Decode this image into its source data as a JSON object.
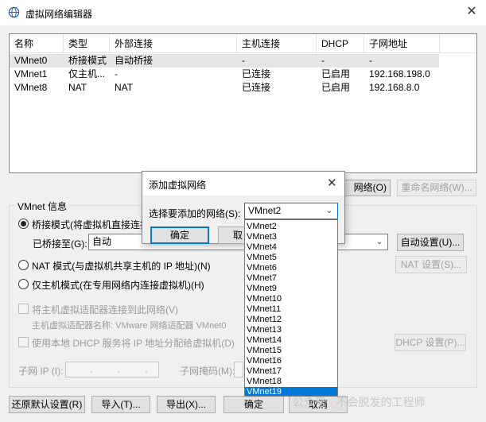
{
  "window": {
    "title": "虚拟网络编辑器",
    "close_glyph": "✕"
  },
  "table": {
    "columns": [
      "名称",
      "类型",
      "外部连接",
      "主机连接",
      "DHCP",
      "子网地址"
    ],
    "rows": [
      [
        "VMnet0",
        "桥接模式",
        "自动桥接",
        "-",
        "-",
        "-"
      ],
      [
        "VMnet1",
        "仅主机...",
        "-",
        "已连接",
        "已启用",
        "192.168.198.0"
      ],
      [
        "VMnet8",
        "NAT",
        "NAT",
        "已连接",
        "已启用",
        "192.168.8.0"
      ]
    ]
  },
  "buttons": {
    "add_network_tail": "网络(O)",
    "rename_network": "重命名网络(W)...",
    "auto_settings": "自动设置(U)...",
    "nat_settings": "NAT 设置(S)...",
    "dhcp_settings": "DHCP 设置(P)...",
    "restore_defaults": "还原默认设置(R)",
    "import": "导入(T)...",
    "export": "导出(X)...",
    "ok": "确定",
    "cancel": "取消"
  },
  "vmnet_info": {
    "title": "VMnet 信息",
    "bridged_mode": "桥接模式(将虚拟机直接连接",
    "bridged_to_label": "已桥接至(G):",
    "bridged_to_value": "自动",
    "nat_mode": "NAT 模式(与虚拟机共享主机的 IP 地址)(N)",
    "host_only_mode": "仅主机模式(在专用网络内连接虚拟机)(H)",
    "connect_host_adapter": "将主机虚拟适配器连接到此网络(V)",
    "host_adapter_name": "主机虚拟适配器名称: VMware 网络适配器 VMnet0",
    "use_local_dhcp": "使用本地 DHCP 服务将 IP 地址分配给虚拟机(D)",
    "subnet_ip_label": "子网 IP (I):",
    "subnet_ip_value": ". . .",
    "subnet_mask_label": "子网掩码(M):"
  },
  "dialog": {
    "title": "添加虚拟网络",
    "close_glyph": "✕",
    "select_label": "选择要添加的网络(S):",
    "selected_value": "VMnet2",
    "ok": "确定",
    "cancel_partial": "取",
    "options": [
      "VMnet2",
      "VMnet3",
      "VMnet4",
      "VMnet5",
      "VMnet6",
      "VMnet7",
      "VMnet9",
      "VMnet10",
      "VMnet11",
      "VMnet12",
      "VMnet13",
      "VMnet14",
      "VMnet15",
      "VMnet16",
      "VMnet17",
      "VMnet18",
      "VMnet19"
    ],
    "highlighted_index": 16
  },
  "watermark": "公众号 · 不会脱发的工程师",
  "colors": {
    "accent": "#0078d7",
    "selection": "#e5e5e5"
  },
  "icons": {
    "app": "network-globe-icon",
    "combo_arrow": "chevron-down-icon"
  }
}
